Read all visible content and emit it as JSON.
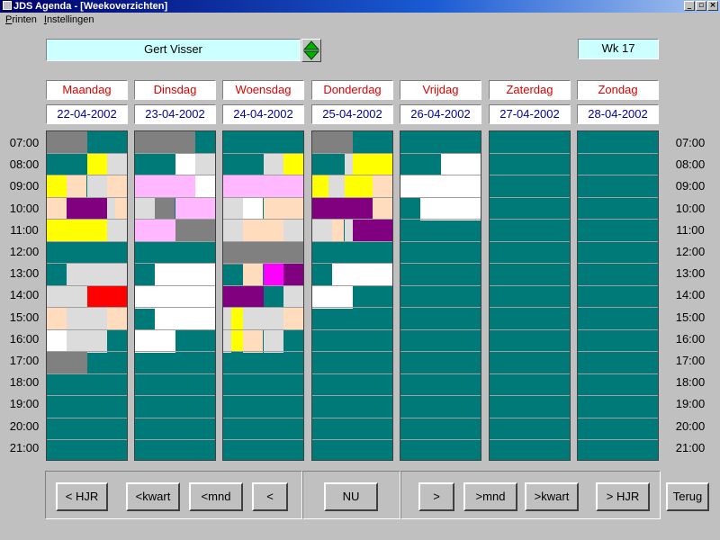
{
  "window": {
    "title": "JDS Agenda - [Weekoverzichten]",
    "controls": [
      "_",
      "▫",
      "×"
    ]
  },
  "menu": {
    "items": [
      "Printen",
      "Instellingen"
    ]
  },
  "user": {
    "name": "Gert Visser"
  },
  "week": {
    "label": "Wk 17"
  },
  "days": [
    {
      "name": "Maandag",
      "date": "22-04-2002"
    },
    {
      "name": "Dinsdag",
      "date": "23-04-2002"
    },
    {
      "name": "Woensdag",
      "date": "24-04-2002"
    },
    {
      "name": "Donderdag",
      "date": "25-04-2002"
    },
    {
      "name": "Vrijdag",
      "date": "26-04-2002"
    },
    {
      "name": "Zaterdag",
      "date": "27-04-2002"
    },
    {
      "name": "Zondag",
      "date": "28-04-2002"
    }
  ],
  "hours": [
    "07:00",
    "08:00",
    "09:00",
    "10:00",
    "11:00",
    "12:00",
    "13:00",
    "14:00",
    "15:00",
    "16:00",
    "17:00",
    "18:00",
    "19:00",
    "20:00",
    "21:00"
  ],
  "colors": {
    "background": "#007a78",
    "grey": "#808080",
    "yellow": "#ffff00",
    "white": "#ffffff",
    "pink": "#ffb8ff",
    "peach": "#ffdcbe",
    "purple": "#800080",
    "red": "#ff0000",
    "magenta": "#ff00ff",
    "lightgrey": "#dcdcdc"
  },
  "appointments": [
    [
      {
        "h": 0,
        "l": 0,
        "r": 0.5,
        "s": 1,
        "c": "grey"
      },
      {
        "h": 1,
        "l": 0.5,
        "r": 0.75,
        "s": 1,
        "c": "yellow"
      },
      {
        "h": 1,
        "l": 0.75,
        "r": 1,
        "s": 1,
        "c": "lightgrey"
      },
      {
        "h": 2,
        "l": 0,
        "r": 0.25,
        "s": 1,
        "c": "yellow"
      },
      {
        "h": 2,
        "l": 0.25,
        "r": 0.5,
        "s": 1,
        "c": "peach"
      },
      {
        "h": 2,
        "l": 0.5,
        "r": 0.75,
        "s": 1,
        "c": "lightgrey"
      },
      {
        "h": 2,
        "l": 0.75,
        "r": 1,
        "s": 1,
        "c": "peach"
      },
      {
        "h": 3,
        "l": 0,
        "r": 0.25,
        "s": 1,
        "c": "peach"
      },
      {
        "h": 3,
        "l": 0.25,
        "r": 0.75,
        "s": 1,
        "c": "purple"
      },
      {
        "h": 3,
        "l": 0.75,
        "r": 0.85,
        "s": 1,
        "c": "lightgrey"
      },
      {
        "h": 3,
        "l": 0.85,
        "r": 1,
        "s": 1,
        "c": "peach"
      },
      {
        "h": 4,
        "l": 0,
        "r": 0.75,
        "s": 1,
        "c": "yellow"
      },
      {
        "h": 4,
        "l": 0.75,
        "r": 1,
        "s": 1,
        "c": "lightgrey"
      },
      {
        "h": 6,
        "l": 0.25,
        "r": 1,
        "s": 1,
        "c": "lightgrey"
      },
      {
        "h": 7,
        "l": 0,
        "r": 0.5,
        "s": 1,
        "c": "lightgrey"
      },
      {
        "h": 7,
        "l": 0.5,
        "r": 1,
        "s": 1,
        "c": "red"
      },
      {
        "h": 8,
        "l": 0,
        "r": 0.25,
        "s": 1,
        "c": "peach"
      },
      {
        "h": 8,
        "l": 0.25,
        "r": 0.75,
        "s": 1,
        "c": "lightgrey"
      },
      {
        "h": 8,
        "l": 0.75,
        "r": 1,
        "s": 1,
        "c": "peach"
      },
      {
        "h": 9,
        "l": 0,
        "r": 0.25,
        "s": 1,
        "c": "white"
      },
      {
        "h": 9,
        "l": 0.25,
        "r": 0.75,
        "s": 1,
        "c": "lightgrey"
      },
      {
        "h": 10,
        "l": 0,
        "r": 0.5,
        "s": 1,
        "c": "grey"
      }
    ],
    [
      {
        "h": 0,
        "l": 0,
        "r": 0.75,
        "s": 1,
        "c": "grey"
      },
      {
        "h": 1,
        "l": 0.5,
        "r": 0.75,
        "s": 1,
        "c": "white"
      },
      {
        "h": 1,
        "l": 0.75,
        "r": 1,
        "s": 1,
        "c": "lightgrey"
      },
      {
        "h": 2,
        "l": 0,
        "r": 0.75,
        "s": 1,
        "c": "pink"
      },
      {
        "h": 2,
        "l": 0.75,
        "r": 1,
        "s": 1,
        "c": "white"
      },
      {
        "h": 3,
        "l": 0,
        "r": 0.25,
        "s": 1,
        "c": "lightgrey"
      },
      {
        "h": 3,
        "l": 0.25,
        "r": 0.5,
        "s": 1,
        "c": "grey"
      },
      {
        "h": 3,
        "l": 0.5,
        "r": 1,
        "s": 1,
        "c": "pink"
      },
      {
        "h": 4,
        "l": 0,
        "r": 0.5,
        "s": 1,
        "c": "pink"
      },
      {
        "h": 4,
        "l": 0.5,
        "r": 1,
        "s": 1,
        "c": "grey"
      },
      {
        "h": 6,
        "l": 0.25,
        "r": 1,
        "s": 1,
        "c": "white"
      },
      {
        "h": 7,
        "l": 0,
        "r": 1,
        "s": 1,
        "c": "white"
      },
      {
        "h": 8,
        "l": 0.25,
        "r": 1,
        "s": 1,
        "c": "white"
      },
      {
        "h": 9,
        "l": 0,
        "r": 0.5,
        "s": 1,
        "c": "white"
      }
    ],
    [
      {
        "h": 1,
        "l": 0.5,
        "r": 0.75,
        "s": 1,
        "c": "lightgrey"
      },
      {
        "h": 1,
        "l": 0.75,
        "r": 1,
        "s": 1,
        "c": "yellow"
      },
      {
        "h": 2,
        "l": 0,
        "r": 1,
        "s": 1,
        "c": "pink"
      },
      {
        "h": 3,
        "l": 0,
        "r": 0.25,
        "s": 1,
        "c": "lightgrey"
      },
      {
        "h": 3,
        "l": 0.25,
        "r": 0.5,
        "s": 1,
        "c": "white"
      },
      {
        "h": 3,
        "l": 0.5,
        "r": 1,
        "s": 1,
        "c": "peach"
      },
      {
        "h": 4,
        "l": 0,
        "r": 0.25,
        "s": 1,
        "c": "lightgrey"
      },
      {
        "h": 4,
        "l": 0.25,
        "r": 0.75,
        "s": 1,
        "c": "peach"
      },
      {
        "h": 4,
        "l": 0.75,
        "r": 1,
        "s": 1,
        "c": "lightgrey"
      },
      {
        "h": 5,
        "l": 0,
        "r": 1,
        "s": 1,
        "c": "grey"
      },
      {
        "h": 6,
        "l": 0.25,
        "r": 0.5,
        "s": 1,
        "c": "peach"
      },
      {
        "h": 6,
        "l": 0.5,
        "r": 0.75,
        "s": 1,
        "c": "magenta"
      },
      {
        "h": 6,
        "l": 0.75,
        "r": 1,
        "s": 1,
        "c": "purple"
      },
      {
        "h": 7,
        "l": 0,
        "r": 0.5,
        "s": 1,
        "c": "purple"
      },
      {
        "h": 7,
        "l": 0.75,
        "r": 1,
        "s": 1,
        "c": "lightgrey"
      },
      {
        "h": 8,
        "l": 0,
        "r": 0.1,
        "s": 1,
        "c": "lightgrey"
      },
      {
        "h": 8,
        "l": 0.1,
        "r": 0.25,
        "s": 2,
        "c": "yellow"
      },
      {
        "h": 8,
        "l": 0.25,
        "r": 0.75,
        "s": 1,
        "c": "lightgrey"
      },
      {
        "h": 8,
        "l": 0.75,
        "r": 1,
        "s": 1,
        "c": "peach"
      },
      {
        "h": 9,
        "l": 0,
        "r": 0.1,
        "s": 1,
        "c": "lightgrey"
      },
      {
        "h": 9,
        "l": 0.25,
        "r": 0.5,
        "s": 1,
        "c": "peach"
      },
      {
        "h": 9,
        "l": 0.5,
        "r": 0.75,
        "s": 1,
        "c": "lightgrey"
      }
    ],
    [
      {
        "h": 0,
        "l": 0,
        "r": 0.5,
        "s": 1,
        "c": "grey"
      },
      {
        "h": 1,
        "l": 0.4,
        "r": 0.5,
        "s": 1,
        "c": "lightgrey"
      },
      {
        "h": 1,
        "l": 0.5,
        "r": 1,
        "s": 1,
        "c": "yellow"
      },
      {
        "h": 2,
        "l": 0,
        "r": 0.2,
        "s": 1,
        "c": "yellow"
      },
      {
        "h": 2,
        "l": 0.2,
        "r": 0.4,
        "s": 1,
        "c": "lightgrey"
      },
      {
        "h": 2,
        "l": 0.4,
        "r": 0.75,
        "s": 1,
        "c": "yellow"
      },
      {
        "h": 2,
        "l": 0.75,
        "r": 1,
        "s": 1,
        "c": "peach"
      },
      {
        "h": 3,
        "l": 0,
        "r": 0.75,
        "s": 1,
        "c": "purple"
      },
      {
        "h": 3,
        "l": 0.75,
        "r": 1,
        "s": 1,
        "c": "peach"
      },
      {
        "h": 4,
        "l": 0,
        "r": 0.25,
        "s": 1,
        "c": "lightgrey"
      },
      {
        "h": 4,
        "l": 0.25,
        "r": 0.4,
        "s": 1,
        "c": "peach"
      },
      {
        "h": 4,
        "l": 0.4,
        "r": 0.5,
        "s": 1,
        "c": "lightgrey"
      },
      {
        "h": 4,
        "l": 0.5,
        "r": 1,
        "s": 1,
        "c": "purple"
      },
      {
        "h": 6,
        "l": 0.25,
        "r": 1,
        "s": 1,
        "c": "white"
      },
      {
        "h": 7,
        "l": 0,
        "r": 0.5,
        "s": 1,
        "c": "white"
      }
    ],
    [
      {
        "h": 1,
        "l": 0.5,
        "r": 1,
        "s": 1,
        "c": "white"
      },
      {
        "h": 2,
        "l": 0,
        "r": 1,
        "s": 1,
        "c": "white"
      },
      {
        "h": 3,
        "l": 0.25,
        "r": 1,
        "s": 1,
        "c": "white"
      }
    ],
    [],
    []
  ],
  "nav": {
    "buttons": [
      "< HJR",
      "<kwart",
      "<mnd",
      "<",
      "NU",
      ">",
      ">mnd",
      ">kwart",
      "> HJR"
    ],
    "back": "Terug"
  }
}
